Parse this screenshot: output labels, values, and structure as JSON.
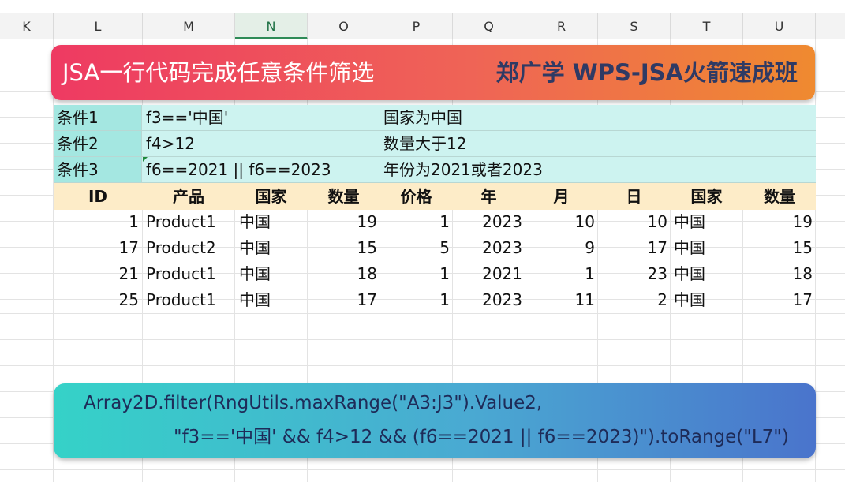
{
  "columns": [
    "K",
    "L",
    "M",
    "N",
    "O",
    "P",
    "Q",
    "R",
    "S",
    "T",
    "U"
  ],
  "active_column": "N",
  "banner": {
    "left_title": "JSA一行代码完成任意条件筛选",
    "right_title": "郑广学 WPS-JSA火箭速成班"
  },
  "conditions": [
    {
      "label": "条件1",
      "expr": "f3=='中国'",
      "desc": "国家为中国"
    },
    {
      "label": "条件2",
      "expr": "f4>12",
      "desc": "数量大于12"
    },
    {
      "label": "条件3",
      "expr": "f6==2021 || f6==2023",
      "desc": "年份为2021或者2023"
    }
  ],
  "table": {
    "headers": [
      "ID",
      "产品",
      "国家",
      "数量",
      "价格",
      "年",
      "月",
      "日",
      "国家",
      "数量"
    ],
    "rows": [
      [
        "1",
        "Product1",
        "中国",
        "19",
        "1",
        "2023",
        "10",
        "10",
        "中国",
        "19"
      ],
      [
        "17",
        "Product2",
        "中国",
        "15",
        "5",
        "2023",
        "9",
        "17",
        "中国",
        "15"
      ],
      [
        "21",
        "Product1",
        "中国",
        "18",
        "1",
        "2021",
        "1",
        "23",
        "中国",
        "18"
      ],
      [
        "25",
        "Product1",
        "中国",
        "17",
        "1",
        "2023",
        "11",
        "2",
        "中国",
        "17"
      ]
    ]
  },
  "code": {
    "line1": "Array2D.filter(RngUtils.maxRange(\"A3:J3\").Value2,",
    "line2": "\"f3=='中国' && f4>12 && (f6==2021 || f6==2023)\").toRange(\"L7\")"
  }
}
